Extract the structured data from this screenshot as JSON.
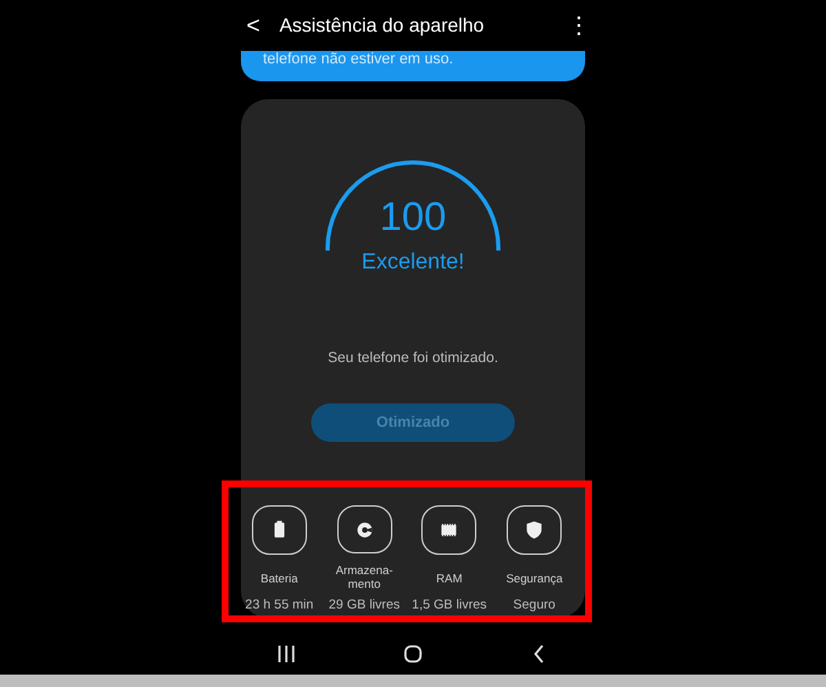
{
  "header": {
    "back": "<",
    "title": "Assistência do aparelho",
    "menu": "⋮"
  },
  "banner": {
    "text": "telefone não estiver em uso."
  },
  "score": {
    "value": "100",
    "level": 1,
    "rating": "Excelente!",
    "message": "Seu telefone foi otimizado."
  },
  "action_button": {
    "label": "Otimizado",
    "disabled": true
  },
  "stats": {
    "highlighted": true,
    "items": [
      {
        "kind": "battery",
        "label": "Bateria",
        "value": "23 h 55 min"
      },
      {
        "kind": "storage",
        "label": "Armazena-\nmento",
        "value": "29 GB livres"
      },
      {
        "kind": "memory",
        "label": "RAM",
        "value": "1,5 GB livres"
      },
      {
        "kind": "security",
        "label": "Segurança",
        "value": "Seguro"
      }
    ]
  },
  "nav_bar": [
    {
      "kind": "recents"
    },
    {
      "kind": "home"
    },
    {
      "kind": "back"
    }
  ]
}
